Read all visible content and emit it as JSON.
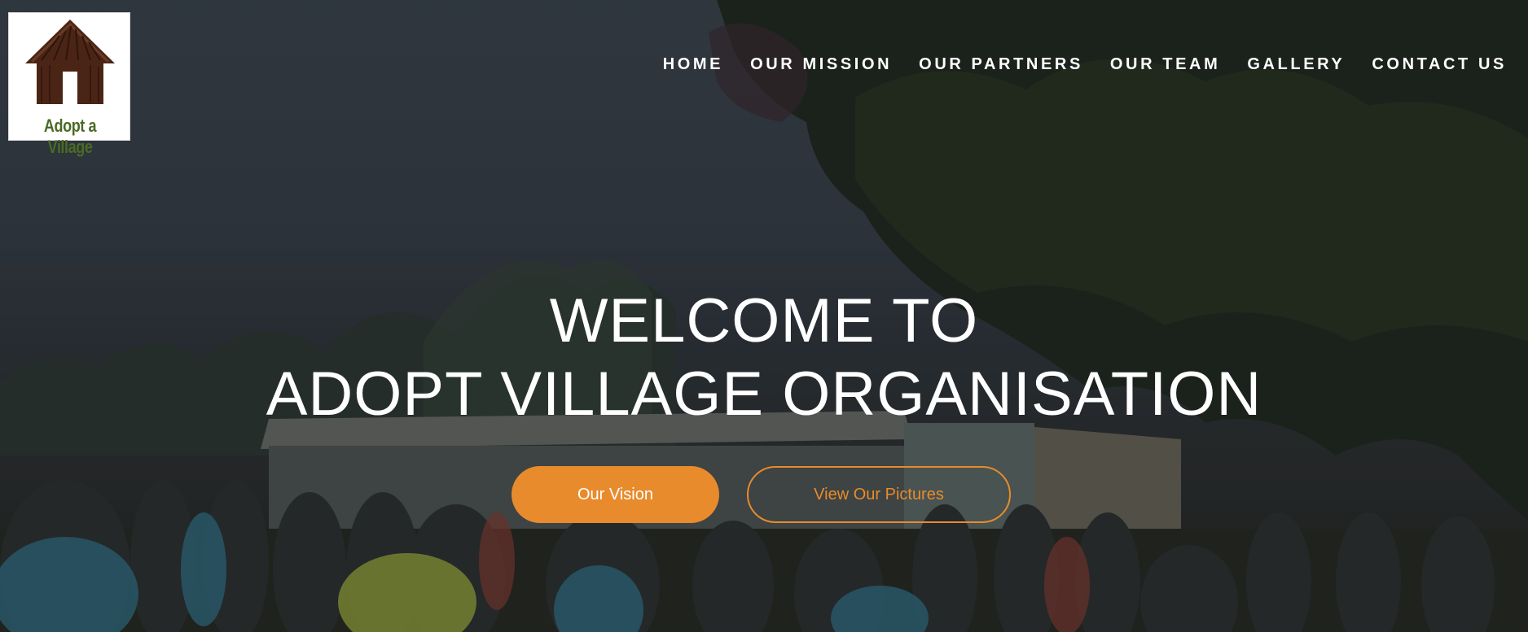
{
  "logo": {
    "text": "Adopt a Village",
    "icon": "thatched-hut-icon"
  },
  "nav": {
    "items": [
      {
        "label": "HOME"
      },
      {
        "label": "OUR MISSION"
      },
      {
        "label": "OUR PARTNERS"
      },
      {
        "label": "OUR TEAM"
      },
      {
        "label": "GALLERY"
      },
      {
        "label": "CONTACT US"
      }
    ]
  },
  "hero": {
    "line1": "WELCOME TO",
    "line2": "ADOPT VILLAGE ORGANISATION",
    "primary_button": "Our Vision",
    "secondary_button": "View Our Pictures"
  },
  "colors": {
    "accent": "#e88b2c",
    "text": "#ffffff",
    "logo_green": "#4a6b24"
  }
}
